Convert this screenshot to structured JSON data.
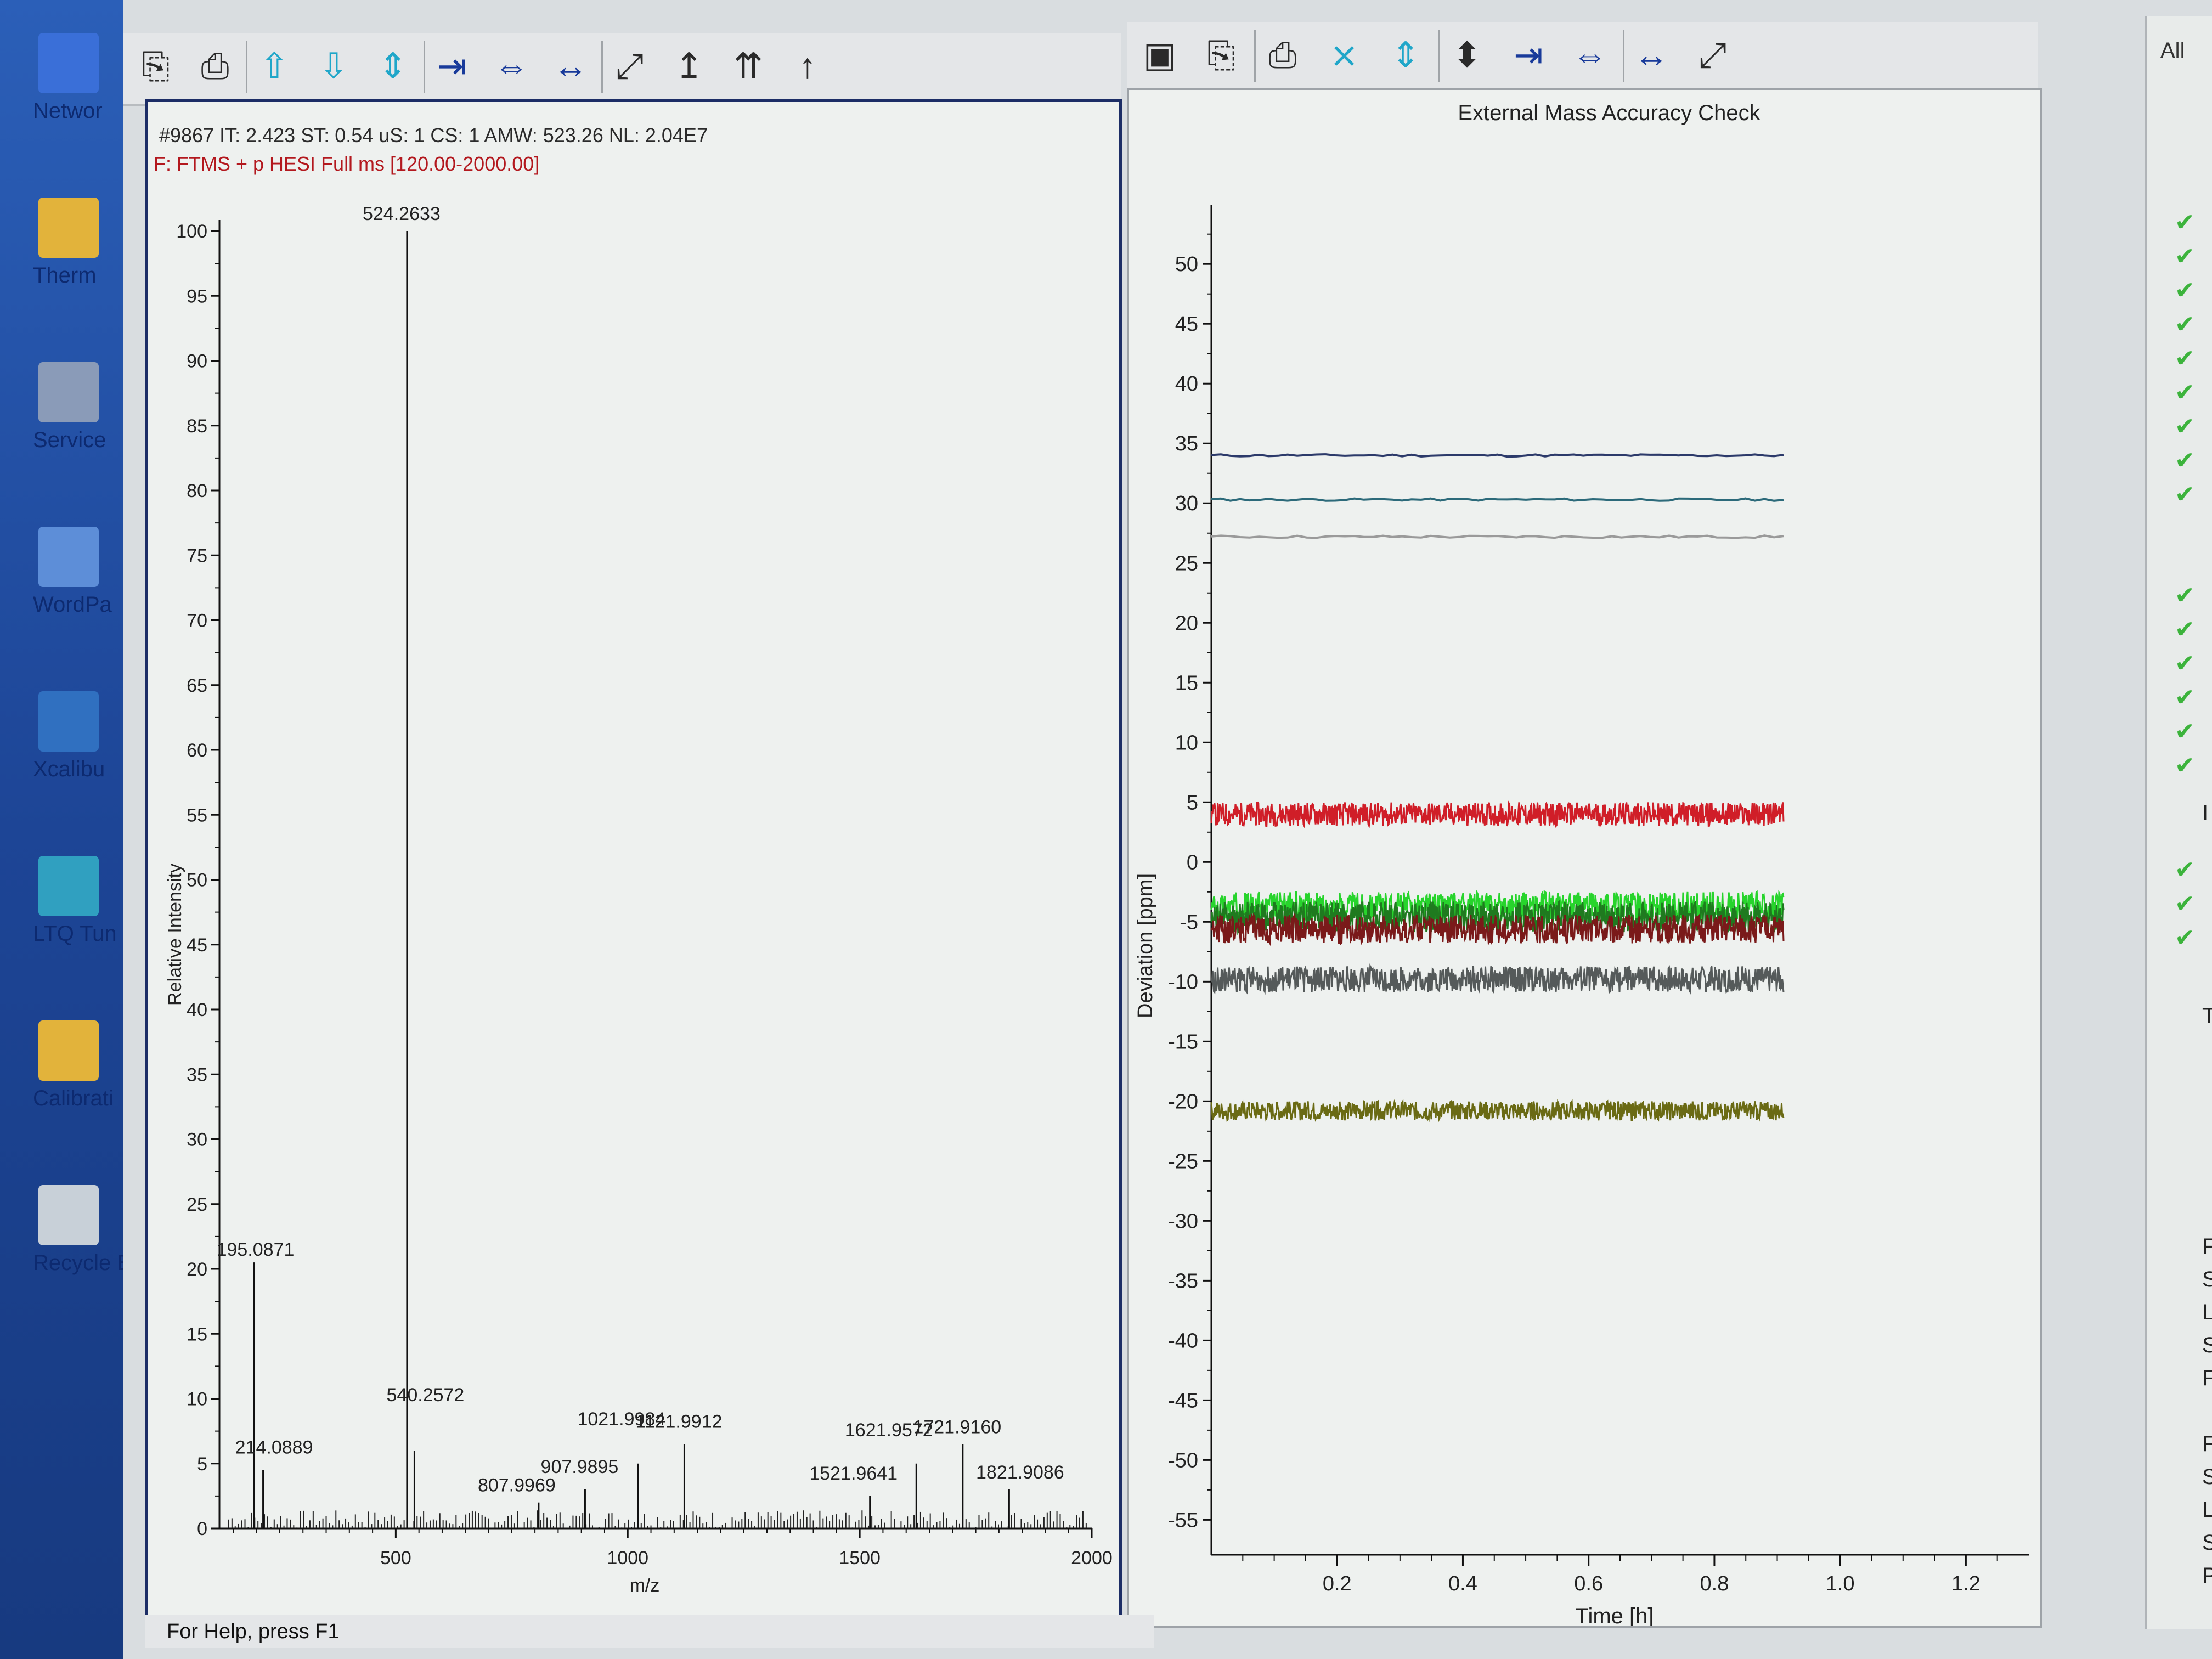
{
  "desktop": {
    "icons": [
      {
        "label": "Networ",
        "icon": "network-icon"
      },
      {
        "label": "Therm",
        "icon": "folder-icon"
      },
      {
        "label": "Service",
        "icon": "gears-icon"
      },
      {
        "label": "WordPa",
        "icon": "wordpad-icon"
      },
      {
        "label": "Xcalibu",
        "icon": "xcalibur-icon"
      },
      {
        "label": "LTQ Tun",
        "icon": "ltq-tune-icon"
      },
      {
        "label": "Calibrati",
        "icon": "folder-icon"
      },
      {
        "label": "Recycle B",
        "icon": "recycle-bin-icon"
      }
    ]
  },
  "spectrum_toolbar": [
    "copy-icon",
    "print-icon",
    "arrow-up-icon",
    "arrow-down-icon",
    "arrow-updown-icon",
    "zoom-in-x-icon",
    "zoom-out-x-icon",
    "autoscale-x-icon",
    "fit-icon",
    "normalize-icon",
    "peak-up-icon",
    "label-up-icon"
  ],
  "trend_toolbar": [
    "save-icon",
    "copy-icon",
    "print-icon",
    "zoom-in-y-icon",
    "zoom-out-y-icon",
    "autoscale-y-icon",
    "zoom-in-x-icon",
    "zoom-out-x-icon",
    "autoscale-x-icon",
    "fit-icon"
  ],
  "spectrum": {
    "header_line1": "#9867  IT: 2.423  ST: 0.54  uS: 1  CS: 1  AMW: 523.26  NL: 2.04E7",
    "header_line2": "F: FTMS + p HESI Full ms [120.00-2000.00]",
    "ylabel": "Relative Intensity",
    "xlabel": "m/z",
    "chart_data": {
      "type": "bar",
      "xlim": [
        120,
        2000
      ],
      "ylim": [
        0,
        100
      ],
      "xticks": [
        500,
        1000,
        1500,
        2000
      ],
      "yticks": [
        0,
        5,
        10,
        15,
        20,
        25,
        30,
        35,
        40,
        45,
        50,
        55,
        60,
        65,
        70,
        75,
        80,
        85,
        90,
        95,
        100
      ],
      "peaks": [
        {
          "mz": 195.0871,
          "rel": 20.5,
          "label": "195.0871"
        },
        {
          "mz": 214.0889,
          "rel": 4.5,
          "label": "214.0889"
        },
        {
          "mz": 524.2633,
          "rel": 100,
          "label": "524.2633"
        },
        {
          "mz": 540.2572,
          "rel": 6.0,
          "label": "540.2572"
        },
        {
          "mz": 807.9969,
          "rel": 2.0,
          "label": "807.9969"
        },
        {
          "mz": 907.9895,
          "rel": 3.0,
          "label": "907.9895"
        },
        {
          "mz": 1021.9984,
          "rel": 5.0,
          "label": "1021.9984"
        },
        {
          "mz": 1121.9912,
          "rel": 6.5,
          "label": "1121.9912"
        },
        {
          "mz": 1521.9641,
          "rel": 2.5,
          "label": "1521.9641"
        },
        {
          "mz": 1621.9572,
          "rel": 5.0,
          "label": "1621.9572"
        },
        {
          "mz": 1721.916,
          "rel": 6.5,
          "label": "1721.9160"
        },
        {
          "mz": 1821.9086,
          "rel": 3.0,
          "label": "1821.9086"
        }
      ]
    }
  },
  "trend": {
    "title": "External Mass Accuracy Check",
    "ylabel": "Deviation [ppm]",
    "xlabel": "Time [h]",
    "chart_data": {
      "type": "line",
      "xlim": [
        0,
        1.3
      ],
      "ylim": [
        -57,
        54
      ],
      "xticks": [
        0.2,
        0.4,
        0.6,
        0.8,
        1.0,
        1.2
      ],
      "yticks": [
        50,
        45,
        40,
        35,
        30,
        25,
        20,
        15,
        10,
        5,
        0,
        -5,
        -10,
        -15,
        -20,
        -25,
        -30,
        -35,
        -40,
        -45,
        -50,
        -55
      ],
      "series": [
        {
          "color": "#2c3a6a",
          "x_end": 0.91,
          "y": 34,
          "noise": 0.1
        },
        {
          "color": "#2c6a7a",
          "x_end": 0.91,
          "y": 30.3,
          "noise": 0.1
        },
        {
          "color": "#9a9a9a",
          "x_end": 0.91,
          "y": 27.2,
          "noise": 0.1
        },
        {
          "color": "#d01e28",
          "x_end": 0.91,
          "y": 4.0,
          "noise": 1.0
        },
        {
          "color": "#27d42c",
          "x_end": 0.91,
          "y": -3.7,
          "noise": 1.2
        },
        {
          "color": "#1f7a1f",
          "x_end": 0.91,
          "y": -4.6,
          "noise": 1.3
        },
        {
          "color": "#7a1a1a",
          "x_end": 0.91,
          "y": -5.6,
          "noise": 1.2
        },
        {
          "color": "#555a5a",
          "x_end": 0.91,
          "y": -9.8,
          "noise": 1.1
        },
        {
          "color": "#6a6a14",
          "x_end": 0.91,
          "y": -20.8,
          "noise": 0.8
        }
      ]
    }
  },
  "right_strip": {
    "header": "All",
    "checks": 18,
    "letters": [
      "I",
      "T",
      "F",
      "S",
      "L",
      "S",
      "F",
      "FT",
      "S",
      "L",
      "S",
      "P"
    ]
  },
  "status_bar": "For Help, press F1"
}
